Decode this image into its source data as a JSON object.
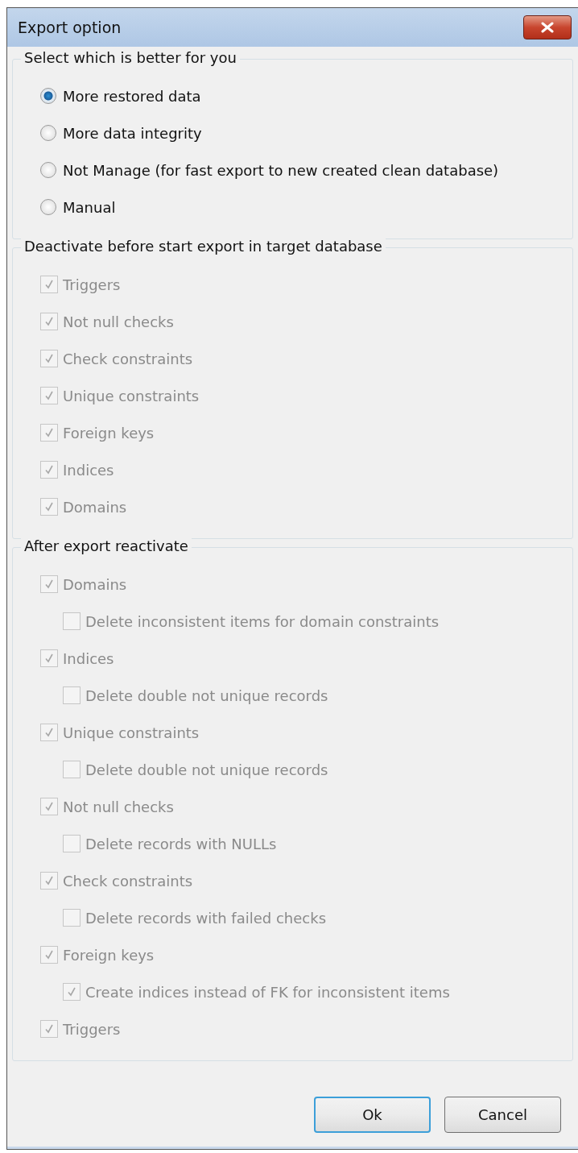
{
  "window": {
    "title": "Export option"
  },
  "groups": [
    {
      "title": "Select which is better for you",
      "kind": "radio",
      "items": [
        {
          "label": "More restored data",
          "selected": true
        },
        {
          "label": "More data integrity",
          "selected": false
        },
        {
          "label": "Not Manage (for fast export to new created clean database)",
          "selected": false
        },
        {
          "label": "Manual",
          "selected": false
        }
      ]
    },
    {
      "title": "Deactivate before start export in target database",
      "kind": "check",
      "items": [
        {
          "label": "Triggers",
          "checked": true,
          "disabled": true
        },
        {
          "label": "Not null checks",
          "checked": true,
          "disabled": true
        },
        {
          "label": "Check constraints",
          "checked": true,
          "disabled": true
        },
        {
          "label": "Unique constraints",
          "checked": true,
          "disabled": true
        },
        {
          "label": "Foreign keys",
          "checked": true,
          "disabled": true
        },
        {
          "label": "Indices",
          "checked": true,
          "disabled": true
        },
        {
          "label": "Domains",
          "checked": true,
          "disabled": true
        }
      ]
    },
    {
      "title": "After export reactivate",
      "kind": "check",
      "items": [
        {
          "label": "Domains",
          "checked": true,
          "disabled": true,
          "children": [
            {
              "label": "Delete inconsistent items for domain constraints",
              "checked": false,
              "disabled": true
            }
          ]
        },
        {
          "label": "Indices",
          "checked": true,
          "disabled": true,
          "children": [
            {
              "label": "Delete double not unique records",
              "checked": false,
              "disabled": true
            }
          ]
        },
        {
          "label": "Unique constraints",
          "checked": true,
          "disabled": true,
          "children": [
            {
              "label": "Delete double not unique records",
              "checked": false,
              "disabled": true
            }
          ]
        },
        {
          "label": "Not null checks",
          "checked": true,
          "disabled": true,
          "children": [
            {
              "label": "Delete records with NULLs",
              "checked": false,
              "disabled": true
            }
          ]
        },
        {
          "label": "Check constraints",
          "checked": true,
          "disabled": true,
          "children": [
            {
              "label": "Delete records with failed checks",
              "checked": false,
              "disabled": true
            }
          ]
        },
        {
          "label": "Foreign keys",
          "checked": true,
          "disabled": true,
          "children": [
            {
              "label": "Create indices instead of FK for inconsistent items",
              "checked": true,
              "disabled": true
            }
          ]
        },
        {
          "label": "Triggers",
          "checked": true,
          "disabled": true
        }
      ]
    }
  ],
  "buttons": [
    {
      "label": "Ok",
      "default": true
    },
    {
      "label": "Cancel",
      "default": false
    }
  ]
}
